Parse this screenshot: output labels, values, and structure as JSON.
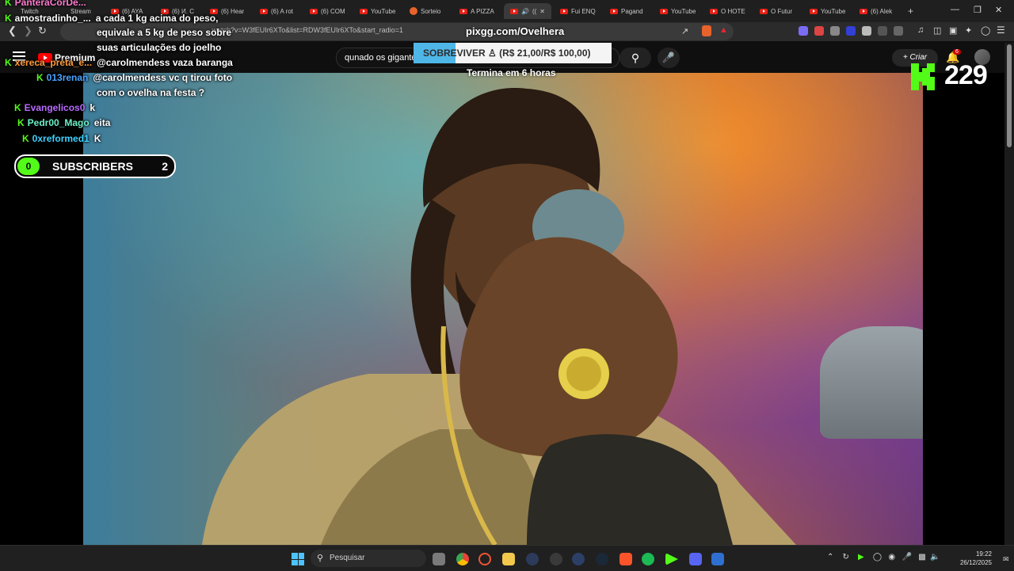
{
  "browser": {
    "tabs": [
      {
        "label": "Twitch"
      },
      {
        "label": "Stream"
      },
      {
        "label": "(6) AYA"
      },
      {
        "label": "(6) И. С"
      },
      {
        "label": "(6) Hear"
      },
      {
        "label": "(6) A rot"
      },
      {
        "label": "(6) COM"
      },
      {
        "label": "YouTube"
      },
      {
        "label": "Sorteio"
      },
      {
        "label": "A PIZZA"
      },
      {
        "label": "(("
      },
      {
        "label": "Fui ENQ"
      },
      {
        "label": "Pagand"
      },
      {
        "label": "YouTube"
      },
      {
        "label": "O HOTE"
      },
      {
        "label": "O Futur"
      },
      {
        "label": "YouTube"
      },
      {
        "label": "(6) Alek"
      }
    ],
    "new_tab": "+",
    "address_url": "...watch?v=W3fEUIr6XTo&list=RDW3fEUIr6XTo&start_radio=1"
  },
  "youtube": {
    "logo_text": "Premium",
    "search_value": "qunado os gigante",
    "create_label": "Criar",
    "notification_count": "6"
  },
  "chat": [
    {
      "user": "PanteraCorDe...",
      "msg": "",
      "user_color": "#ff7ad1"
    },
    {
      "user": "amostradinho_...",
      "msg": "a cada 1 kg acima do peso,",
      "user_color": "#ffffff"
    },
    {
      "user": "",
      "msg": "equivale a 5 kg de peso sobre",
      "user_color": "#ffffff"
    },
    {
      "user": "",
      "msg": "suas articulações do joelho",
      "user_color": "#ffffff"
    },
    {
      "user": "xereca_preta_e...",
      "msg": "@carolmendess vaza baranga",
      "user_color": "#ff9a3c"
    },
    {
      "user": "013renan",
      "msg": "@carolmendess vc q tirou foto",
      "user_color": "#4aa3ff"
    },
    {
      "user": "",
      "msg": "com o ovelha na festa ?",
      "user_color": "#ffffff"
    },
    {
      "user": "Evangelicos0",
      "msg": "k",
      "user_color": "#b86bff"
    },
    {
      "user": "Pedr00_Mago",
      "msg": "eita",
      "user_color": "#6cf0c7"
    },
    {
      "user": "0xreformed1",
      "msg": "K",
      "user_color": "#3fd1ff"
    }
  ],
  "subscribers": {
    "left": "0",
    "label": "SUBSCRIBERS",
    "right": "2"
  },
  "pix": {
    "url": "pixgg.com/Ovelhera",
    "goal_text": "SOBREVIVER ♙ (R$ 21,00/R$ 100,00)",
    "progress": 0.21,
    "subtitle": "Termina em 6 horas"
  },
  "kick": {
    "viewers": "229"
  },
  "taskbar": {
    "search_label": "Pesquisar",
    "time": "19:22",
    "date": "26/12/2025"
  },
  "colors": {
    "kick_green": "#53fc18",
    "pix_blue": "#4fb6e8"
  }
}
